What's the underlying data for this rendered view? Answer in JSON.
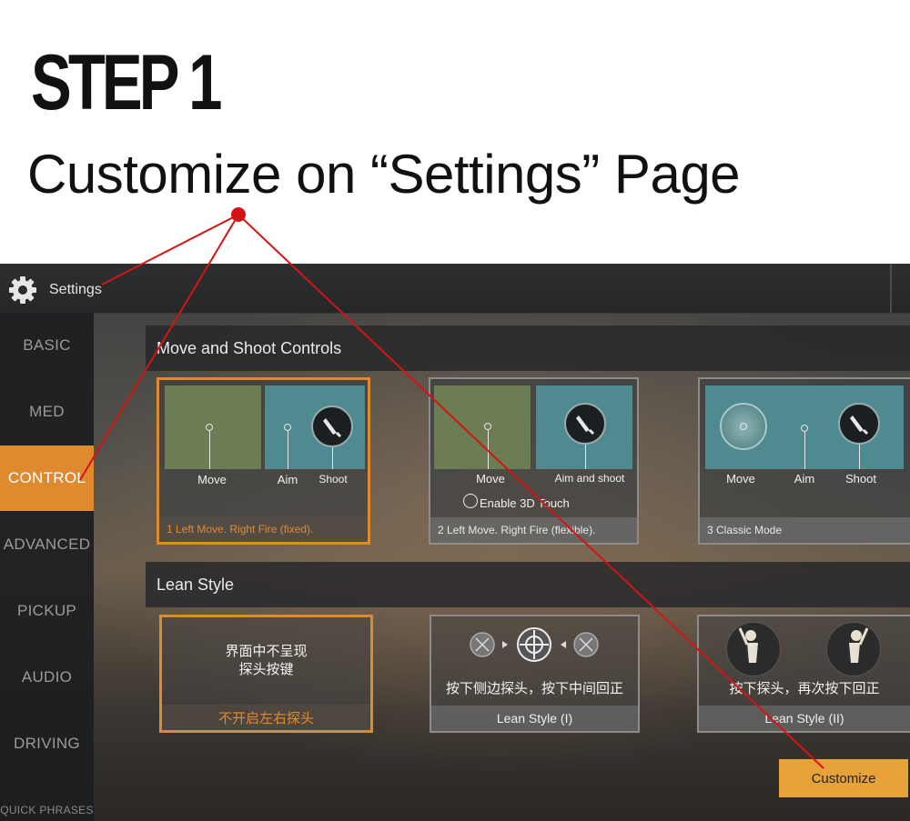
{
  "header": {
    "step": "STEP 1",
    "subtitle": "Customize on “Settings” Page"
  },
  "topbar": {
    "icon": "gear-icon",
    "title": "Settings"
  },
  "sidebar": {
    "items": [
      {
        "label": "BASIC"
      },
      {
        "label": "MED"
      },
      {
        "label": "CONTROL",
        "active": true
      },
      {
        "label": "ADVANCED"
      },
      {
        "label": "PICKUP"
      },
      {
        "label": "AUDIO"
      },
      {
        "label": "DRIVING"
      },
      {
        "label": "QUICK PHRASES"
      }
    ]
  },
  "move_shoot": {
    "header": "Move and Shoot Controls",
    "cards": [
      {
        "labels": [
          "Move",
          "Aim",
          "Shoot"
        ],
        "caption": "1  Left Move. Right Fire (fixed).",
        "selected": true
      },
      {
        "labels": [
          "Move",
          "Aim and shoot"
        ],
        "option": "Enable 3D Touch",
        "caption": "2 Left Move. Right Fire (flexible).",
        "selected": false
      },
      {
        "labels": [
          "Move",
          "Aim",
          "Shoot"
        ],
        "caption": "3 Classic Mode",
        "selected": false
      }
    ]
  },
  "lean": {
    "header": "Lean Style",
    "cards": [
      {
        "text_line1": "界面中不呈现",
        "text_line2": "探头按键",
        "caption": "不开启左右探头",
        "selected": true
      },
      {
        "text_line1": "按下侧边探头，按下中间回正",
        "caption": "Lean Style (I)",
        "selected": false
      },
      {
        "text_line1": "按下探头，再次按下回正",
        "caption": "Lean Style (II)",
        "selected": false
      }
    ]
  },
  "customize_button": "Customize",
  "colors": {
    "accent": "#e08a30",
    "annotation": "#d41414",
    "button": "#e8a23a"
  }
}
